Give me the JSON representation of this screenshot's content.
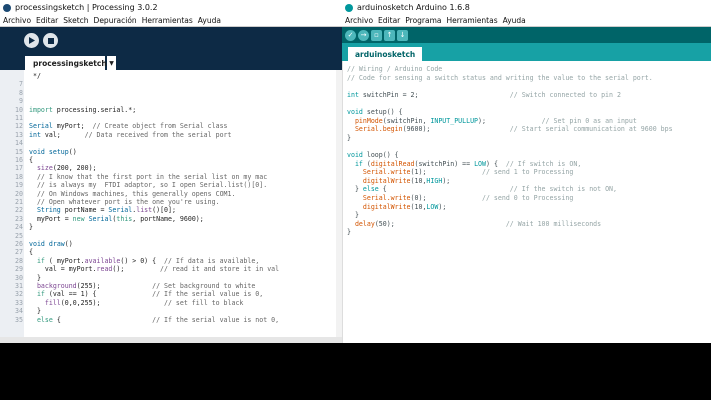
{
  "processing": {
    "window_title": "processingsketch | Processing 3.0.2",
    "menu": [
      "Archivo",
      "Editar",
      "Sketch",
      "Depuración",
      "Herramientas",
      "Ayuda"
    ],
    "tab": "processingsketch",
    "code": [
      {
        "n": "",
        "t": " */"
      },
      {
        "n": "7",
        "t": ""
      },
      {
        "n": "8",
        "t": ""
      },
      {
        "n": "9",
        "t": ""
      },
      {
        "n": "10",
        "t": "import processing.serial.*;"
      },
      {
        "n": "11",
        "t": ""
      },
      {
        "n": "12",
        "t": "Serial myPort;  // Create object from Serial class"
      },
      {
        "n": "13",
        "t": "int val;      // Data received from the serial port"
      },
      {
        "n": "14",
        "t": ""
      },
      {
        "n": "15",
        "t": "void setup()"
      },
      {
        "n": "16",
        "t": "{"
      },
      {
        "n": "17",
        "t": "  size(200, 200);"
      },
      {
        "n": "18",
        "t": "  // I know that the first port in the serial list on my mac"
      },
      {
        "n": "19",
        "t": "  // is always my  FTDI adaptor, so I open Serial.list()[0]."
      },
      {
        "n": "20",
        "t": "  // On Windows machines, this generally opens COM1."
      },
      {
        "n": "21",
        "t": "  // Open whatever port is the one you're using."
      },
      {
        "n": "22",
        "t": "  String portName = Serial.list()[0];"
      },
      {
        "n": "23",
        "t": "  myPort = new Serial(this, portName, 9600);"
      },
      {
        "n": "24",
        "t": "}"
      },
      {
        "n": "25",
        "t": ""
      },
      {
        "n": "26",
        "t": "void draw()"
      },
      {
        "n": "27",
        "t": "{"
      },
      {
        "n": "28",
        "t": "  if ( myPort.available() > 0) {  // If data is available,"
      },
      {
        "n": "29",
        "t": "    val = myPort.read();         // read it and store it in val"
      },
      {
        "n": "30",
        "t": "  }"
      },
      {
        "n": "31",
        "t": "  background(255);             // Set background to white"
      },
      {
        "n": "32",
        "t": "  if (val == 1) {              // If the serial value is 0,"
      },
      {
        "n": "33",
        "t": "    fill(0,0,255);                // set fill to black"
      },
      {
        "n": "34",
        "t": "  }"
      },
      {
        "n": "35",
        "t": "  else {                       // If the serial value is not 0,"
      }
    ]
  },
  "arduino": {
    "window_title": "arduinosketch Arduino 1.6.8",
    "menu": [
      "Archivo",
      "Editar",
      "Programa",
      "Herramientas",
      "Ayuda"
    ],
    "tab": "arduinosketch",
    "code": [
      "// Wiring / Arduino Code",
      "// Code for sensing a switch status and writing the value to the serial port.",
      "",
      "int switchPin = 2;                       // Switch connected to pin 2",
      "",
      "void setup() {",
      "  pinMode(switchPin, INPUT_PULLUP);              // Set pin 0 as an input",
      "  Serial.begin(9600);                    // Start serial communication at 9600 bps",
      "}",
      "",
      "void loop() {",
      "  if (digitalRead(switchPin) == LOW) {  // If switch is ON,",
      "    Serial.write(1);              // send 1 to Processing",
      "    digitalWrite(10,HIGH);",
      "  } else {                               // If the switch is not ON,",
      "    Serial.write(0);              // send 0 to Processing",
      "    digitalWrite(10,LOW);",
      "  }",
      "  delay(50);                            // Wait 100 milliseconds",
      "}"
    ]
  },
  "colors": {
    "processing_toolbar": "#0d2a45",
    "arduino_toolbar": "#006468",
    "arduino_tabbar": "#17a1a5"
  }
}
